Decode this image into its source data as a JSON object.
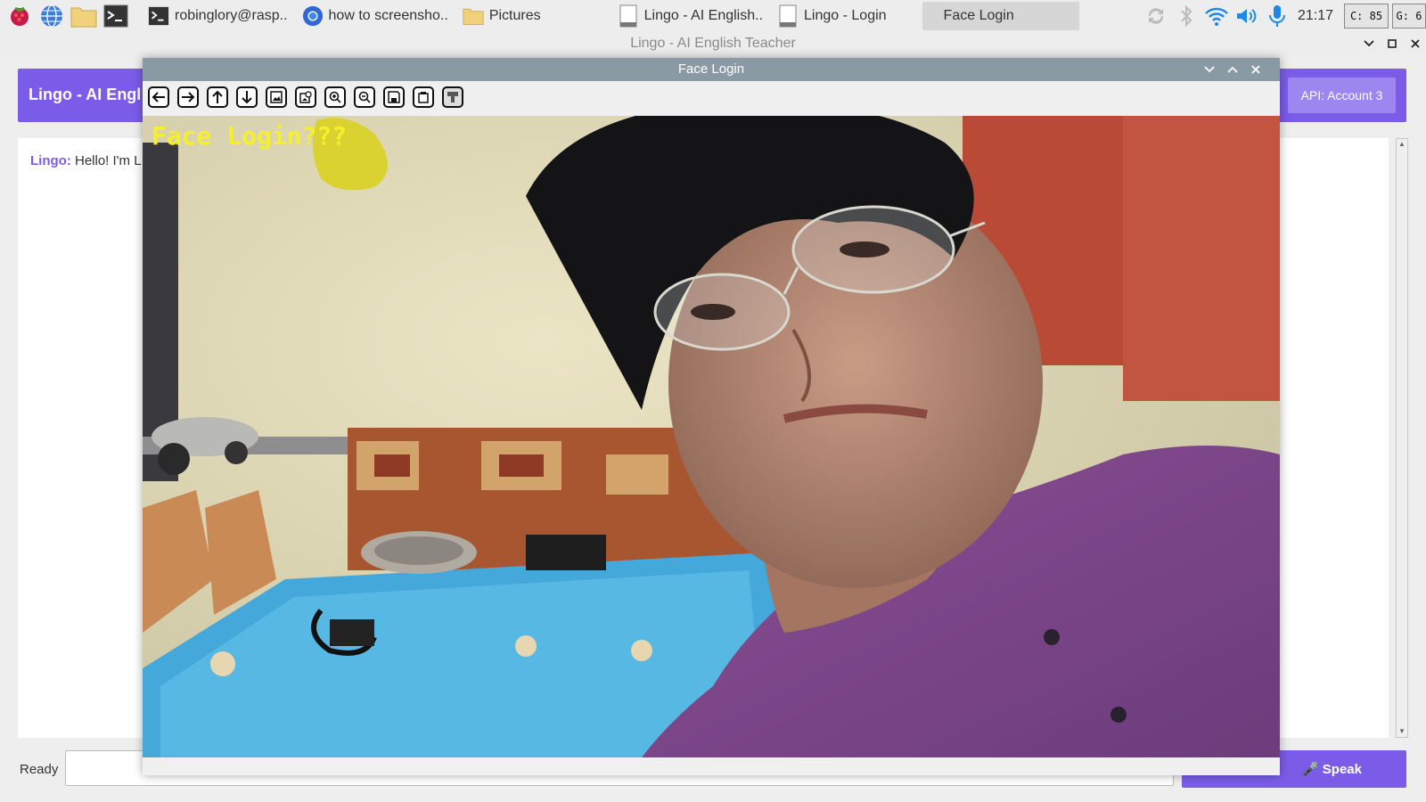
{
  "taskbar": {
    "tasks": [
      {
        "label": "robinglory@rasp..",
        "icon": "terminal-icon"
      },
      {
        "label": "how to screensho..",
        "icon": "browser-icon"
      },
      {
        "label": "Pictures",
        "icon": "folder-icon"
      },
      {
        "label": "Lingo - AI English..",
        "icon": "window-icon"
      },
      {
        "label": "Lingo - Login",
        "icon": "window-icon"
      },
      {
        "label": "Face Login",
        "icon": "window-icon",
        "active": true
      }
    ],
    "clock": "21:17",
    "cpu_monitor": "C: 85",
    "gpu_monitor": "G: 6"
  },
  "app": {
    "window_title": "Lingo - AI English Teacher",
    "header_title": "Lingo - AI Engl",
    "api_button": "API: Account 3",
    "chat": {
      "speaker": "Lingo:",
      "message": "Hello! I'm L"
    },
    "status": "Ready",
    "speak_button": "🎤 Speak"
  },
  "face_window": {
    "title": "Face Login",
    "overlay_text": "Face Login???",
    "toolbar": [
      "arrow-left-icon",
      "arrow-right-icon",
      "arrow-up-icon",
      "arrow-down-icon",
      "image-icon",
      "image-search-icon",
      "zoom-in-icon",
      "zoom-out-icon",
      "save-icon",
      "copy-icon",
      "properties-icon"
    ]
  },
  "colors": {
    "accent": "#7b5ce8",
    "accent_light": "#9c86f0",
    "overlay_text": "#f4f02a"
  }
}
